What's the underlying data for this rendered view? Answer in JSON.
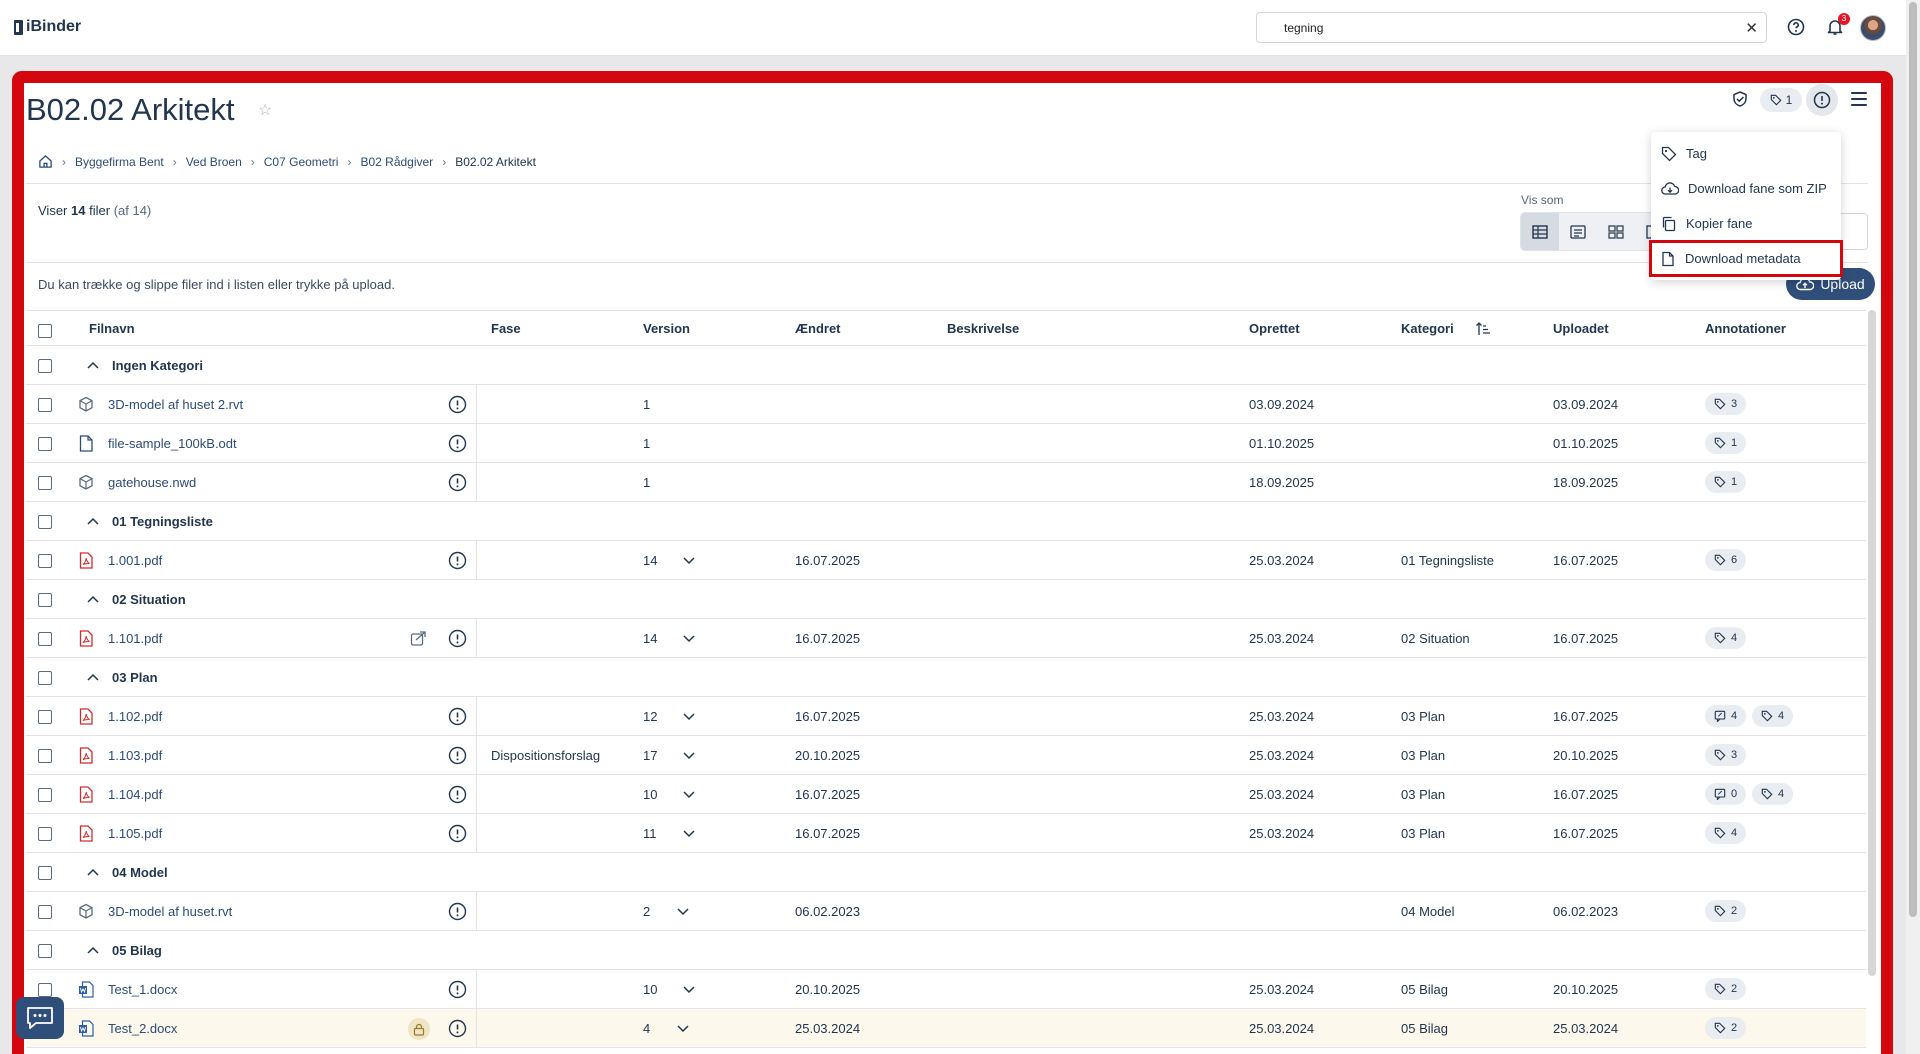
{
  "app": {
    "logo_text": "iBinder"
  },
  "search": {
    "value": "tegning"
  },
  "notifications": {
    "count": "3"
  },
  "page": {
    "title": "B02.02 Arkitekt",
    "tag_count": "1"
  },
  "breadcrumb": [
    "Byggefirma Bent",
    "Ved Broen",
    "C07 Geometri",
    "B02 Rådgiver",
    "B02.02 Arkitekt"
  ],
  "summary": {
    "prefix": "Viser",
    "count": "14",
    "unit": "filer",
    "total": "(af 14)"
  },
  "view": {
    "label": "Vis som"
  },
  "hint": "Du kan trække og slippe filer ind i listen eller trykke på upload.",
  "upload_label": "Upload",
  "menu": [
    "Tag",
    "Download fane som ZIP",
    "Kopier fane",
    "Download metadata"
  ],
  "columns": {
    "filnavn": "Filnavn",
    "fase": "Fase",
    "version": "Version",
    "aendret": "Ændret",
    "beskrivelse": "Beskrivelse",
    "oprettet": "Oprettet",
    "kategori": "Kategori",
    "uploadet": "Uploadet",
    "annotationer": "Annotationer"
  },
  "rows": [
    {
      "type": "group",
      "name": "Ingen Kategori"
    },
    {
      "type": "file",
      "icon": "model",
      "name": "3D-model af huset 2.rvt",
      "fase": "",
      "version": "1",
      "chev": false,
      "changed": "",
      "created": "03.09.2024",
      "category": "",
      "uploaded": "03.09.2024",
      "tags": "3"
    },
    {
      "type": "file",
      "icon": "doc",
      "name": "file-sample_100kB.odt",
      "fase": "",
      "version": "1",
      "chev": false,
      "changed": "",
      "created": "01.10.2025",
      "category": "",
      "uploaded": "01.10.2025",
      "tags": "1"
    },
    {
      "type": "file",
      "icon": "model",
      "name": "gatehouse.nwd",
      "fase": "",
      "version": "1",
      "chev": false,
      "changed": "",
      "created": "18.09.2025",
      "category": "",
      "uploaded": "18.09.2025",
      "tags": "1"
    },
    {
      "type": "group",
      "name": "01 Tegningsliste"
    },
    {
      "type": "file",
      "icon": "pdf",
      "name": "1.001.pdf",
      "fase": "",
      "version": "14",
      "chev": true,
      "changed": "16.07.2025",
      "created": "25.03.2024",
      "category": "01 Tegningsliste",
      "uploaded": "16.07.2025",
      "tags": "6"
    },
    {
      "type": "group",
      "name": "02 Situation"
    },
    {
      "type": "file",
      "icon": "pdf",
      "name": "1.101.pdf",
      "share": true,
      "fase": "",
      "version": "14",
      "chev": true,
      "changed": "16.07.2025",
      "created": "25.03.2024",
      "category": "02 Situation",
      "uploaded": "16.07.2025",
      "tags": "4"
    },
    {
      "type": "group",
      "name": "03 Plan"
    },
    {
      "type": "file",
      "icon": "pdf",
      "name": "1.102.pdf",
      "fase": "",
      "version": "12",
      "chev": true,
      "changed": "16.07.2025",
      "created": "25.03.2024",
      "category": "03 Plan",
      "uploaded": "16.07.2025",
      "comments": "4",
      "tags": "4"
    },
    {
      "type": "file",
      "icon": "pdf",
      "name": "1.103.pdf",
      "fase": "Dispositionsforslag",
      "version": "17",
      "chev": true,
      "changed": "20.10.2025",
      "created": "25.03.2024",
      "category": "03 Plan",
      "uploaded": "20.10.2025",
      "tags": "3"
    },
    {
      "type": "file",
      "icon": "pdf",
      "name": "1.104.pdf",
      "fase": "",
      "version": "10",
      "chev": true,
      "changed": "16.07.2025",
      "created": "25.03.2024",
      "category": "03 Plan",
      "uploaded": "16.07.2025",
      "comments": "0",
      "tags": "4"
    },
    {
      "type": "file",
      "icon": "pdf",
      "name": "1.105.pdf",
      "fase": "",
      "version": "11",
      "chev": true,
      "changed": "16.07.2025",
      "created": "25.03.2024",
      "category": "03 Plan",
      "uploaded": "16.07.2025",
      "tags": "4"
    },
    {
      "type": "group",
      "name": "04 Model"
    },
    {
      "type": "file",
      "icon": "model",
      "name": "3D-model af huset.rvt",
      "fase": "",
      "version": "2",
      "chev": true,
      "changed": "06.02.2023",
      "created": "",
      "category": "04 Model",
      "uploaded": "06.02.2023",
      "tags": "2"
    },
    {
      "type": "group",
      "name": "05 Bilag"
    },
    {
      "type": "file",
      "icon": "word",
      "name": "Test_1.docx",
      "fase": "",
      "version": "10",
      "chev": true,
      "changed": "20.10.2025",
      "created": "25.03.2024",
      "category": "05 Bilag",
      "uploaded": "20.10.2025",
      "tags": "2"
    },
    {
      "type": "file",
      "icon": "word",
      "name": "Test_2.docx",
      "locked": true,
      "fase": "",
      "version": "4",
      "chev": true,
      "changed": "25.03.2024",
      "created": "25.03.2024",
      "category": "05 Bilag",
      "uploaded": "25.03.2024",
      "tags": "2"
    }
  ]
}
